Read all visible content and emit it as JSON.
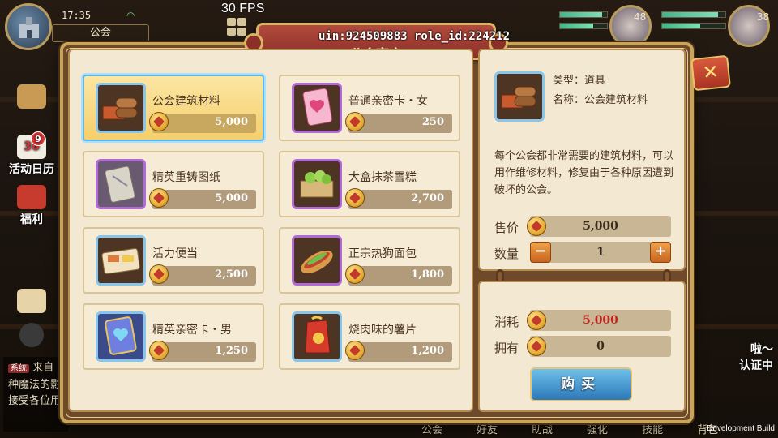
{
  "hud": {
    "time": "17:35",
    "guild_label": "公会",
    "fps": "30 FPS",
    "player1_level": "48",
    "player2_level": "38",
    "debug_ids": "uin:924509883 role_id:224212"
  },
  "side_menu": {
    "calendar_day": "36",
    "calendar_badge": "9",
    "calendar_label": "活动日历",
    "welfare_label": "福利"
  },
  "chat": {
    "tag": "系统",
    "line1": "来自",
    "line2": "种魔法的影",
    "line3": "接受各位用"
  },
  "bottom_nav": [
    "公会",
    "好友",
    "助战",
    "强化",
    "技能",
    "背包"
  ],
  "right_side": {
    "certify_label": "认证中",
    "bubble_text": "啦～"
  },
  "dev_build": "Development Build",
  "shop": {
    "title": "公会商店",
    "items": [
      {
        "name": "公会建筑材料",
        "price": "5,000",
        "icon": "lumber-bricks-icon",
        "frame": "blue",
        "selected": true
      },
      {
        "name": "普通亲密卡・女",
        "price": "250",
        "icon": "pink-heart-card-icon",
        "frame": "purple",
        "selected": false
      },
      {
        "name": "精英重铸图纸",
        "price": "5,000",
        "icon": "blueprint-scroll-icon",
        "frame": "purple",
        "selected": false
      },
      {
        "name": "大盒抹茶雪糕",
        "price": "2,700",
        "icon": "matcha-box-icon",
        "frame": "purple",
        "selected": false
      },
      {
        "name": "活力便当",
        "price": "2,500",
        "icon": "bento-box-icon",
        "frame": "blue",
        "selected": false
      },
      {
        "name": "正宗热狗面包",
        "price": "1,800",
        "icon": "hotdog-icon",
        "frame": "purple",
        "selected": false
      },
      {
        "name": "精英亲密卡・男",
        "price": "1,250",
        "icon": "blue-heart-card-icon",
        "frame": "blue",
        "selected": false
      },
      {
        "name": "烧肉味的薯片",
        "price": "1,200",
        "icon": "chips-bag-icon",
        "frame": "blue",
        "selected": false
      }
    ]
  },
  "detail": {
    "type_label": "类型：道具",
    "name_label": "名称：公会建筑材料",
    "description": "每个公会都非常需要的建筑材料，可以用作维修材料，修复由于各种原因遭到破坏的公会。",
    "price_label": "售价",
    "price_value": "5,000",
    "qty_label": "数量",
    "qty_value": "1",
    "minus": "−",
    "plus": "+"
  },
  "cost": {
    "spend_label": "消耗",
    "spend_value": "5,000",
    "own_label": "拥有",
    "own_value": "0",
    "buy_label": "购买"
  },
  "colors": {
    "frame_gold": "#c9a55c",
    "title_red": "#8c2f28",
    "selected_card": "#f5cf6c",
    "spend_red": "#c0261f",
    "buy_blue": "#2c78b8"
  }
}
